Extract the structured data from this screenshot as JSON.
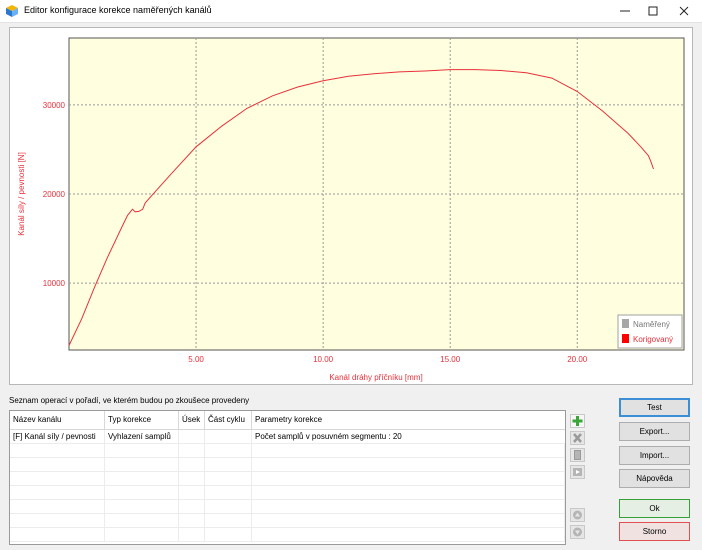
{
  "window": {
    "title": "Editor konfigurace korekce naměřených kanálů"
  },
  "chart_data": {
    "type": "line",
    "xlabel": "Kanál dráhy příčníku  [mm]",
    "ylabel": "Kanál síly / pevnosti  [N]",
    "xlim": [
      0,
      24.2
    ],
    "ylim": [
      2500,
      37500
    ],
    "x_ticks": [
      5,
      10,
      15,
      20
    ],
    "x_tick_labels": [
      "5.00",
      "10.00",
      "15.00",
      "20.00"
    ],
    "y_ticks": [
      10000,
      20000,
      30000
    ],
    "y_tick_labels": [
      "10000",
      "20000",
      "30000"
    ],
    "grid": true,
    "legend_position": "bottom-right",
    "legend": [
      {
        "label": "Naměřený",
        "color": "#a6a6a6"
      },
      {
        "label": "Korigovaný",
        "color": "#ff0000"
      }
    ],
    "plot_background": "#ffffe0",
    "series": [
      {
        "color": "#e8303a",
        "x": [
          0,
          0.5,
          1,
          1.5,
          2,
          2.3,
          2.5,
          2.6,
          2.75,
          2.9,
          3.0,
          3.5,
          4,
          5,
          6,
          7,
          8,
          9,
          10,
          11,
          12,
          13,
          14,
          15,
          16,
          17,
          18,
          19,
          20,
          21,
          22,
          22.5,
          22.8,
          22.9,
          23.0
        ],
        "y": [
          3000,
          6000,
          9500,
          12800,
          15800,
          17600,
          18300,
          18000,
          18050,
          18300,
          19000,
          20600,
          22200,
          25300,
          27600,
          29600,
          31000,
          32000,
          32700,
          33200,
          33500,
          33700,
          33800,
          33950,
          33950,
          33850,
          33600,
          33000,
          31500,
          29300,
          26800,
          25300,
          24300,
          23600,
          22800
        ]
      }
    ]
  },
  "operations": {
    "caption": "Seznam operací v pořadí, ve kterém budou po zkoušece provedeny",
    "columns": [
      "Název kanálu",
      "Typ korekce",
      "Úsek",
      "Část cyklu",
      "Parametry korekce"
    ],
    "rows": [
      [
        "[F]  Kanál síly / pevnosti",
        "Vyhlazení samplů",
        "",
        "",
        "Počet samplů v posuvném segmentu : 20"
      ]
    ]
  },
  "buttons": {
    "test": "Test",
    "export": "Export...",
    "import": "Import...",
    "help": "Nápověda",
    "ok": "Ok",
    "cancel": "Storno"
  }
}
